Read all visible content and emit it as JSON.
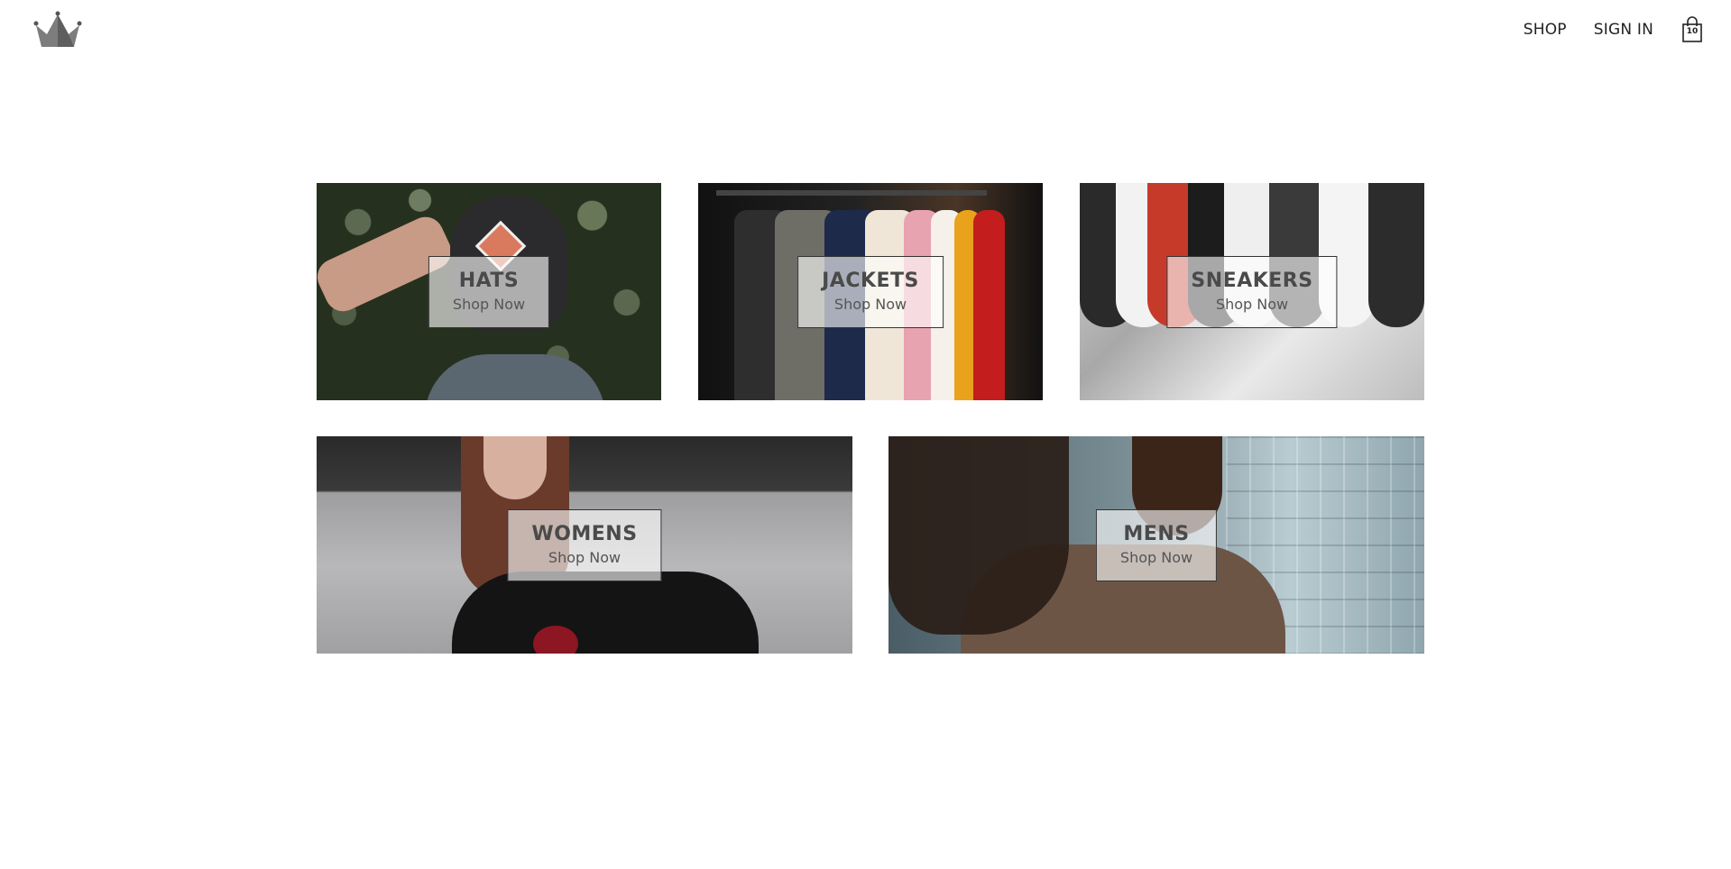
{
  "header": {
    "logo": "crown-logo",
    "nav": [
      {
        "label": "SHOP"
      },
      {
        "label": "SIGN IN"
      }
    ],
    "cart": {
      "icon": "shopping-bag-icon",
      "count": "10"
    }
  },
  "directory": {
    "sections": [
      {
        "title": "HATS",
        "subtitle": "Shop Now"
      },
      {
        "title": "JACKETS",
        "subtitle": "Shop Now"
      },
      {
        "title": "SNEAKERS",
        "subtitle": "Shop Now"
      },
      {
        "title": "WOMENS",
        "subtitle": "Shop Now"
      },
      {
        "title": "MENS",
        "subtitle": "Shop Now"
      }
    ]
  },
  "colors": {
    "text": "#333333",
    "label_bg": "rgba(255,255,255,0.62)",
    "logo": "#808080"
  }
}
